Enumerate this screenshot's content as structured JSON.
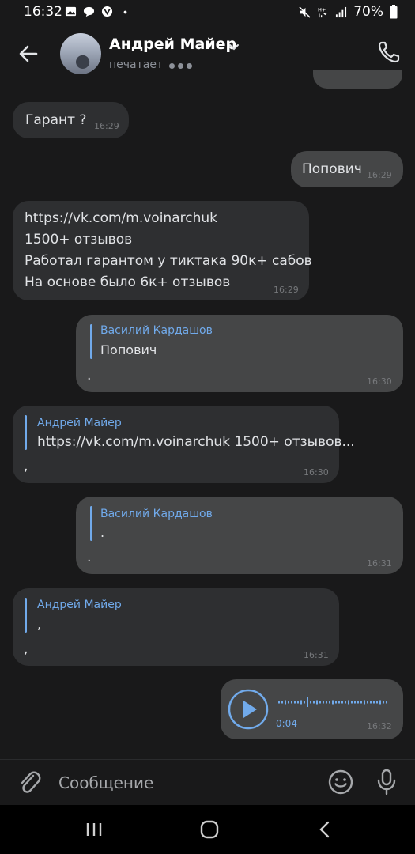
{
  "status_bar": {
    "time": "16:32",
    "battery": "70%"
  },
  "header": {
    "contact_name": "Андрей Майер",
    "status": "печатает"
  },
  "messages": [
    {
      "text": "Гарант ?",
      "time": "16:29"
    },
    {
      "text": "Попович",
      "time": "16:29"
    },
    {
      "link": "https://vk.com/m.voinarchuk",
      "lines": [
        "1500+ отзывов",
        "Работал гарантом у тиктака 90к+ сабов",
        "На основе было 6к+ отзывов"
      ],
      "time": "16:29"
    },
    {
      "reply_author": "Василий Кардашов",
      "reply_text": "Попович",
      "text": ".",
      "time": "16:30"
    },
    {
      "reply_author": "Андрей Майер",
      "reply_text": "https://vk.com/m.voinarchuk 1500+ отзывов...",
      "text": ",",
      "time": "16:30"
    },
    {
      "reply_author": "Василий Кардашов",
      "reply_text": ".",
      "text": ".",
      "time": "16:31"
    },
    {
      "reply_author": "Андрей Майер",
      "reply_text": ",",
      "text": ",",
      "time": "16:31"
    },
    {
      "voice_duration": "0:04",
      "time": "16:32"
    }
  ],
  "input": {
    "placeholder": "Сообщение"
  },
  "colors": {
    "background": "#19191a",
    "incoming_bubble": "#2e2f31",
    "outgoing_bubble": "#454647",
    "accent": "#71aaeb"
  }
}
